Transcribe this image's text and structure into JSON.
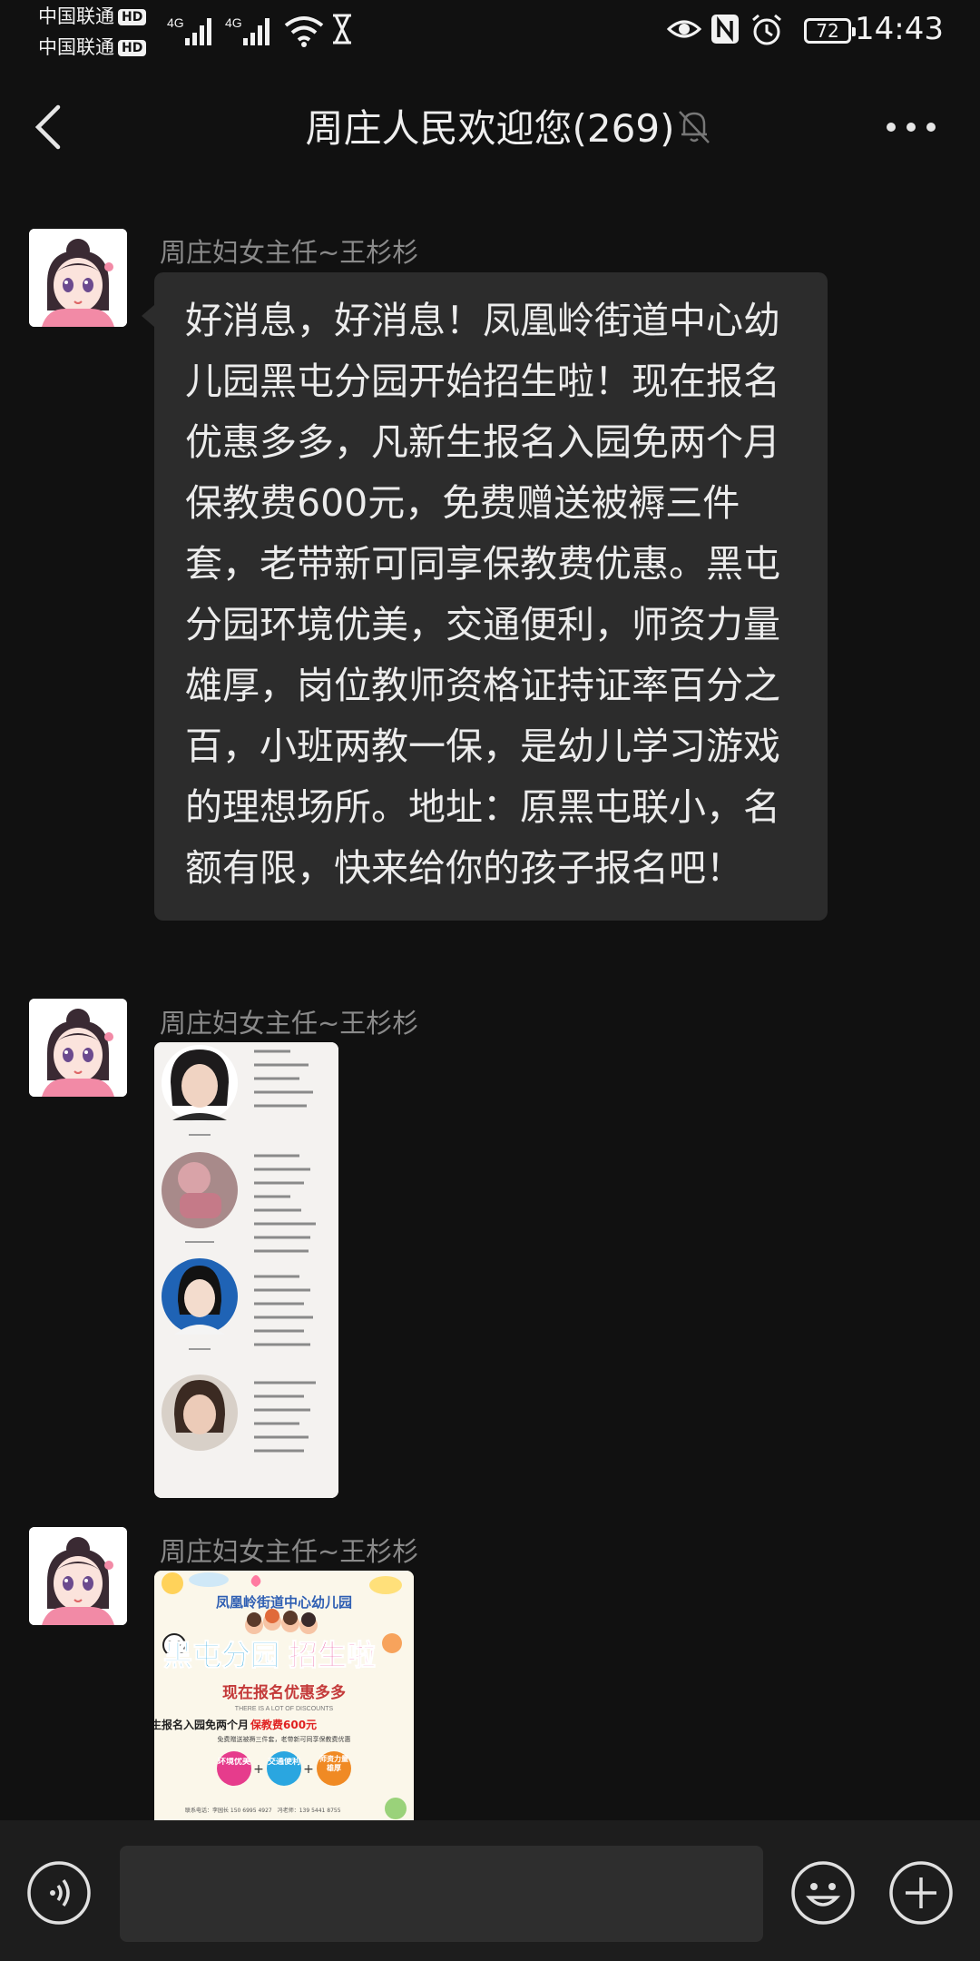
{
  "status_bar": {
    "carrier1": "中国联通",
    "carrier2": "中国联通",
    "hd": "HD",
    "net1": "4G",
    "net2": "4G",
    "battery": "72",
    "time": "14:43"
  },
  "header": {
    "title": "周庄人民欢迎您(269)"
  },
  "messages": [
    {
      "sender": "周庄妇女主任~王杉杉",
      "type": "text",
      "text": "好消息，好消息！凤凰岭街道中心幼儿园黑屯分园开始招生啦！现在报名优惠多多，凡新生报名入园免两个月保教费600元，免费赠送被褥三件套，老带新可同享保教费优惠。黑屯分园环境优美，交通便利，师资力量雄厚，岗位教师资格证持证率百分之百，小班两教一保，是幼儿学习游戏的理想场所。地址：原黑屯联小，名额有限，快来给你的孩子报名吧！"
    },
    {
      "sender": "周庄妇女主任~王杉杉",
      "type": "image"
    },
    {
      "sender": "周庄妇女主任~王杉杉",
      "type": "image",
      "poster": {
        "org": "凤凰岭街道中心幼儿园",
        "headline_a": "黑屯分园",
        "headline_b": "招生啦",
        "sub": "现在报名优惠多多",
        "en": "THERE IS A LOT OF DISCOUNTS",
        "line1": "凡新生报名入园免两个月",
        "line1_red": "保教费600元",
        "line2": "免费赠送被褥三件套，老带新可同享保教费优惠",
        "badge1": "环境优美",
        "badge2": "交通便利",
        "badge3": "师资力量雄厚",
        "contact": "联系电话：李园长 150 6995 4927　冯老师：139 5441 8755"
      }
    }
  ],
  "colors": {
    "background": "#111111",
    "bubble": "#2c2c2c",
    "sender_text": "#8a8a8a",
    "bottom_bar": "#1d1d1d"
  },
  "icons": {
    "back": "chevron-left-icon",
    "mute": "bell-off-icon",
    "more": "more-dots-icon",
    "voice": "voice-icon",
    "emoji": "emoji-icon",
    "plus": "plus-icon"
  }
}
